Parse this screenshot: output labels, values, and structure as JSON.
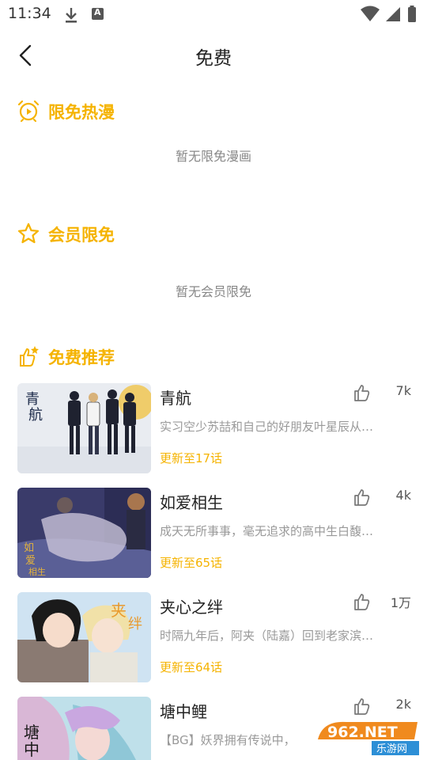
{
  "status_bar": {
    "time": "11:34"
  },
  "header": {
    "title": "免费"
  },
  "sections": {
    "limited_hot": {
      "title": "限免热漫",
      "empty": "暂无限免漫画"
    },
    "member_free": {
      "title": "会员限免",
      "empty": "暂无会员限免"
    },
    "recommend": {
      "title": "免费推荐"
    }
  },
  "comics": [
    {
      "title": "青航",
      "desc": "实习空少苏喆和自己的好朋友叶星辰从…",
      "episode": "更新至17话",
      "likes": "7k"
    },
    {
      "title": "如爱相生",
      "desc": "成天无所事事，毫无追求的高中生白馥…",
      "episode": "更新至65话",
      "likes": "4k"
    },
    {
      "title": "夹心之绊",
      "desc": "时隔九年后，阿夹（陆嘉）回到老家滨…",
      "episode": "更新至64话",
      "likes": "1万"
    },
    {
      "title": "塘中鲤",
      "desc": "【BG】妖界拥有传说中，",
      "episode": "",
      "likes": "2k"
    }
  ],
  "watermark": {
    "top": "962.NET",
    "bottom": "乐游网"
  },
  "colors": {
    "accent": "#f5b300",
    "text": "#222222",
    "muted": "#999999"
  },
  "icons": [
    "download-icon",
    "a-notification-icon",
    "wifi-icon",
    "signal-icon",
    "battery-icon",
    "back-arrow-icon",
    "alarm-clock-icon",
    "star-icon",
    "thumbs-up-sparkle-icon",
    "thumbs-up-icon"
  ]
}
